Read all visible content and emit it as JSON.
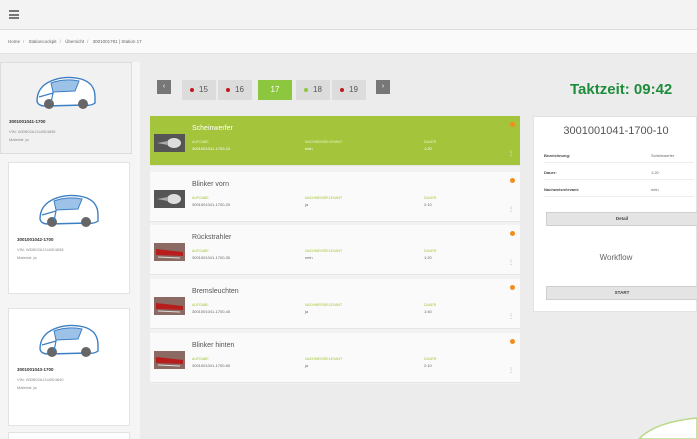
{
  "breadcrumb": [
    "Home",
    "Stationcockpit",
    "Übersicht",
    "3001001781 | Station 17"
  ],
  "sidebar": {
    "cars": [
      {
        "id": "3001001041-1700",
        "vin": "VIN: WDB02AJ1U6D4836",
        "material": "Material: ja"
      },
      {
        "id": "3001001042-1700",
        "vin": "VIN: WDB02AJ1U6D4838",
        "material": "Material: ja"
      },
      {
        "id": "3001001043-1700",
        "vin": "VIN: WDB02AJ1U6D4840",
        "material": "Material: ja"
      }
    ]
  },
  "stations": {
    "prev": "‹",
    "next": "›",
    "items": [
      {
        "label": "15",
        "dot": "red"
      },
      {
        "label": "16",
        "dot": "red"
      },
      {
        "label": "17",
        "dot": "none"
      },
      {
        "label": "18",
        "dot": "green"
      },
      {
        "label": "19",
        "dot": "red"
      }
    ]
  },
  "takt": "Taktzeit: 09:42",
  "tasks": {
    "col_labels": [
      "AUFGABE",
      "NACHWEISRELEVANT",
      "DAUER"
    ],
    "items": [
      {
        "title": "Scheinwerfer",
        "code": "3001001041-1700-10",
        "nachweis": "nein",
        "dauer": "1:20",
        "thumb": "headlight"
      },
      {
        "title": "Blinker vorn",
        "code": "3001001041-1700-20",
        "nachweis": "ja",
        "dauer": "2:10",
        "thumb": "headlight"
      },
      {
        "title": "Rückstrahler",
        "code": "3001001041-1700-30",
        "nachweis": "nein",
        "dauer": "1:20",
        "thumb": "taillight"
      },
      {
        "title": "Bremsleuchten",
        "code": "3001001041-1700-40",
        "nachweis": "ja",
        "dauer": "1:40",
        "thumb": "taillight"
      },
      {
        "title": "Blinker hinten",
        "code": "3001001041-1700-50",
        "nachweis": "ja",
        "dauer": "2:10",
        "thumb": "taillight"
      }
    ]
  },
  "detail": {
    "title": "3001001041-1700-10",
    "rows": [
      {
        "k": "Bezeichnung:",
        "v": "Scheinwerfer"
      },
      {
        "k": "Dauer:",
        "v": "1:20"
      },
      {
        "k": "Nachweisrelevant:",
        "v": "nein"
      }
    ],
    "detail_button": "Detail",
    "workflow": "Workflow",
    "start_button": "START"
  },
  "colors": {
    "accent": "#8dc63f",
    "selected": "#a4c43c",
    "takt": "#1e8c3a",
    "status": "#f28c1d",
    "stop": "#c4161c"
  }
}
